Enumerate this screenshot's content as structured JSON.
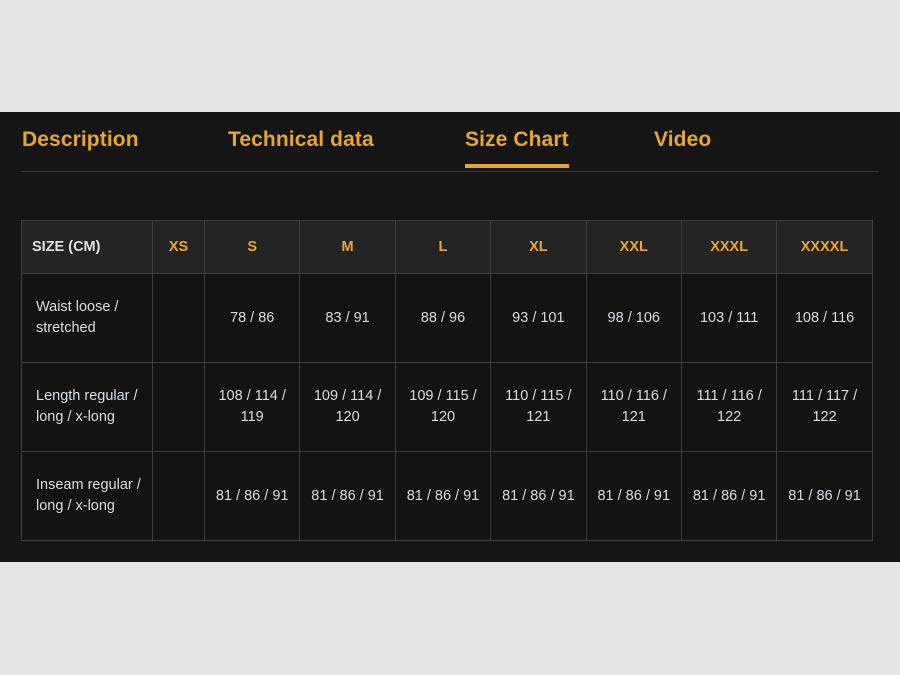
{
  "theme": {
    "page_background": "#e6e6e6",
    "panel_background": "#151515",
    "accent": "#e9a62b",
    "table_header_background": "#242424",
    "table_body_background": "#131313",
    "table_border": "#3d3d3d",
    "body_text": "#d9dde1"
  },
  "tabs": [
    {
      "label": "Description",
      "active": false
    },
    {
      "label": "Technical data",
      "active": false
    },
    {
      "label": "Size Chart",
      "active": true
    },
    {
      "label": "Video",
      "active": false
    }
  ],
  "size_chart": {
    "header": {
      "label": "SIZE (CM)",
      "sizes": [
        "XS",
        "S",
        "M",
        "L",
        "XL",
        "XXL",
        "XXXL",
        "XXXXL"
      ]
    },
    "rows": [
      {
        "label": "Waist loose / stretched",
        "values": [
          "",
          "78 / 86",
          "83 / 91",
          "88 / 96",
          "93 / 101",
          "98 / 106",
          "103 / 111",
          "108 / 116"
        ]
      },
      {
        "label": "Length regular / long / x-long",
        "values": [
          "",
          "108 / 114 / 119",
          "109 / 114 / 120",
          "109 / 115 / 120",
          "110 / 115 / 121",
          "110 / 116 / 121",
          "111 / 116 / 122",
          "111 / 117 / 122"
        ]
      },
      {
        "label": "Inseam regular / long / x-long",
        "values": [
          "",
          "81 / 86 / 91",
          "81 / 86 / 91",
          "81 / 86 / 91",
          "81 / 86 / 91",
          "81 / 86 / 91",
          "81 / 86 / 91",
          "81 / 86 / 91"
        ]
      }
    ]
  }
}
